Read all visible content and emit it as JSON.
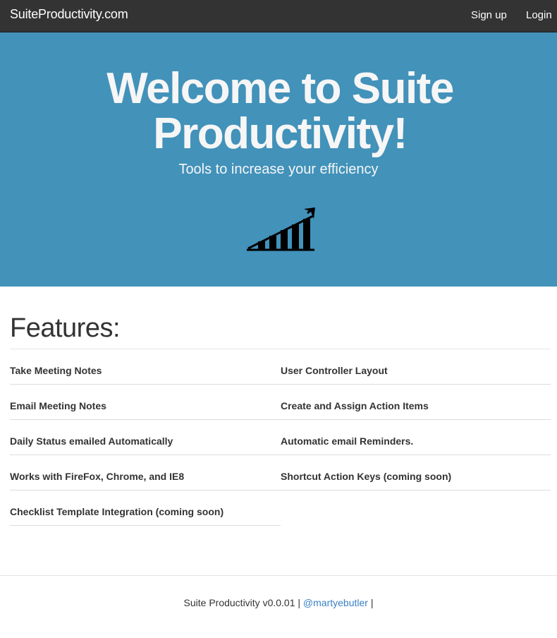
{
  "navbar": {
    "brand": "SuiteProductivity.com",
    "links": [
      "Sign up",
      "Login"
    ]
  },
  "hero": {
    "title": "Welcome to Suite Productivity!",
    "subtitle": "Tools to increase your efficiency",
    "icon": "growth-chart-icon"
  },
  "features": {
    "title": "Features:",
    "items": [
      "Take Meeting Notes",
      "User Controller Layout",
      "Email Meeting Notes",
      "Create and Assign Action Items",
      "Daily Status emailed Automatically",
      "Automatic email Reminders.",
      "Works with FireFox, Chrome, and IE8",
      "Shortcut Action Keys (coming soon)",
      "Checklist Template Integration (coming soon)"
    ]
  },
  "footer": {
    "text": "Suite Productivity v0.0.01",
    "separator": "|",
    "link": "@martyebutler"
  },
  "colors": {
    "navbar": "#333333",
    "hero": "#4292ba",
    "link": "#3a80c4"
  }
}
